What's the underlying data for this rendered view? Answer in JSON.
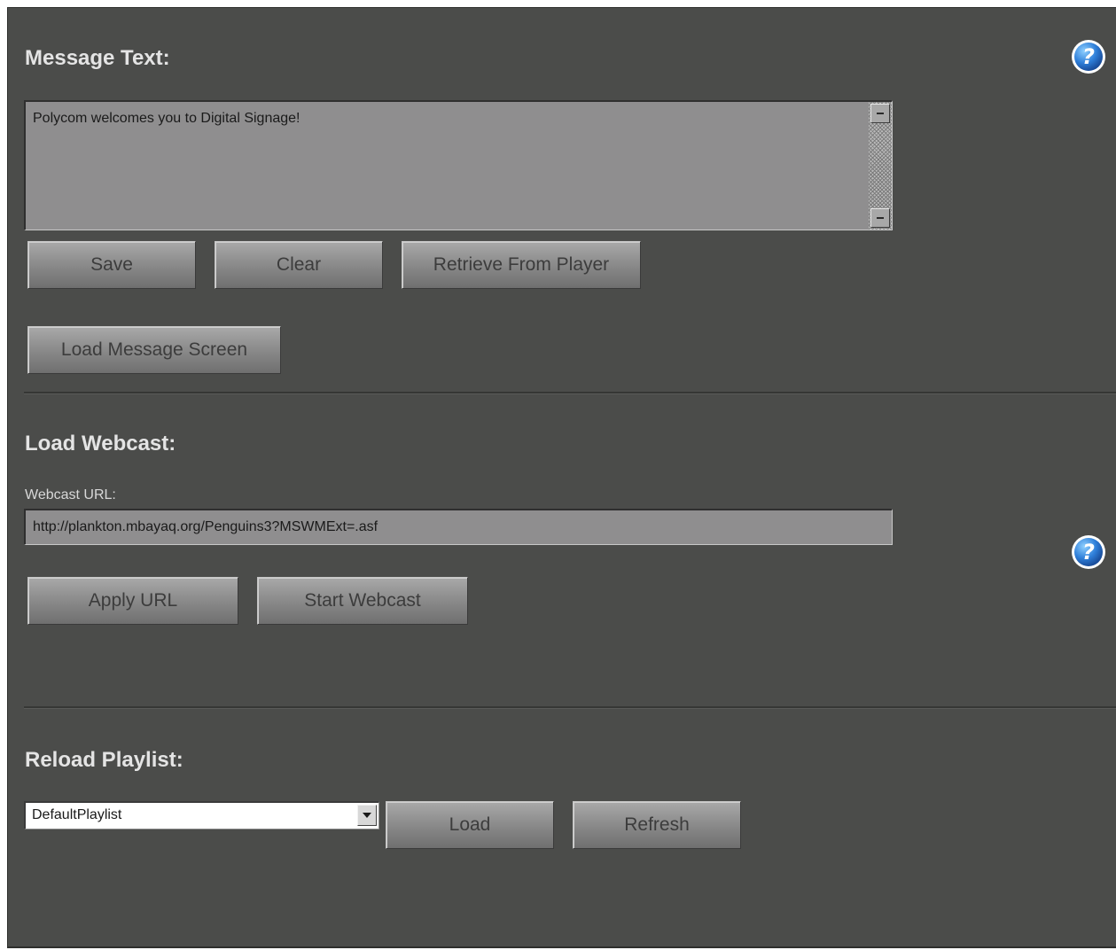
{
  "message_section": {
    "heading": "Message Text:",
    "text_value": "Polycom welcomes you to Digital Signage!",
    "buttons": {
      "save": "Save",
      "clear": "Clear",
      "retrieve": "Retrieve From Player",
      "load_message_screen": "Load Message Screen"
    },
    "help_icon": "help-icon"
  },
  "webcast_section": {
    "heading": "Load Webcast:",
    "url_label": "Webcast URL:",
    "url_value": "http://plankton.mbayaq.org/Penguins3?MSWMExt=.asf",
    "buttons": {
      "apply_url": "Apply URL",
      "start_webcast": "Start Webcast"
    },
    "help_icon": "help-icon"
  },
  "playlist_section": {
    "heading": "Reload Playlist:",
    "selected_playlist": "DefaultPlaylist",
    "buttons": {
      "load": "Load",
      "refresh": "Refresh"
    }
  },
  "colors": {
    "panel_bg": "#4b4c4a",
    "help_icon_blue": "#2f7fd9",
    "button_text": "#3c3c3c"
  }
}
